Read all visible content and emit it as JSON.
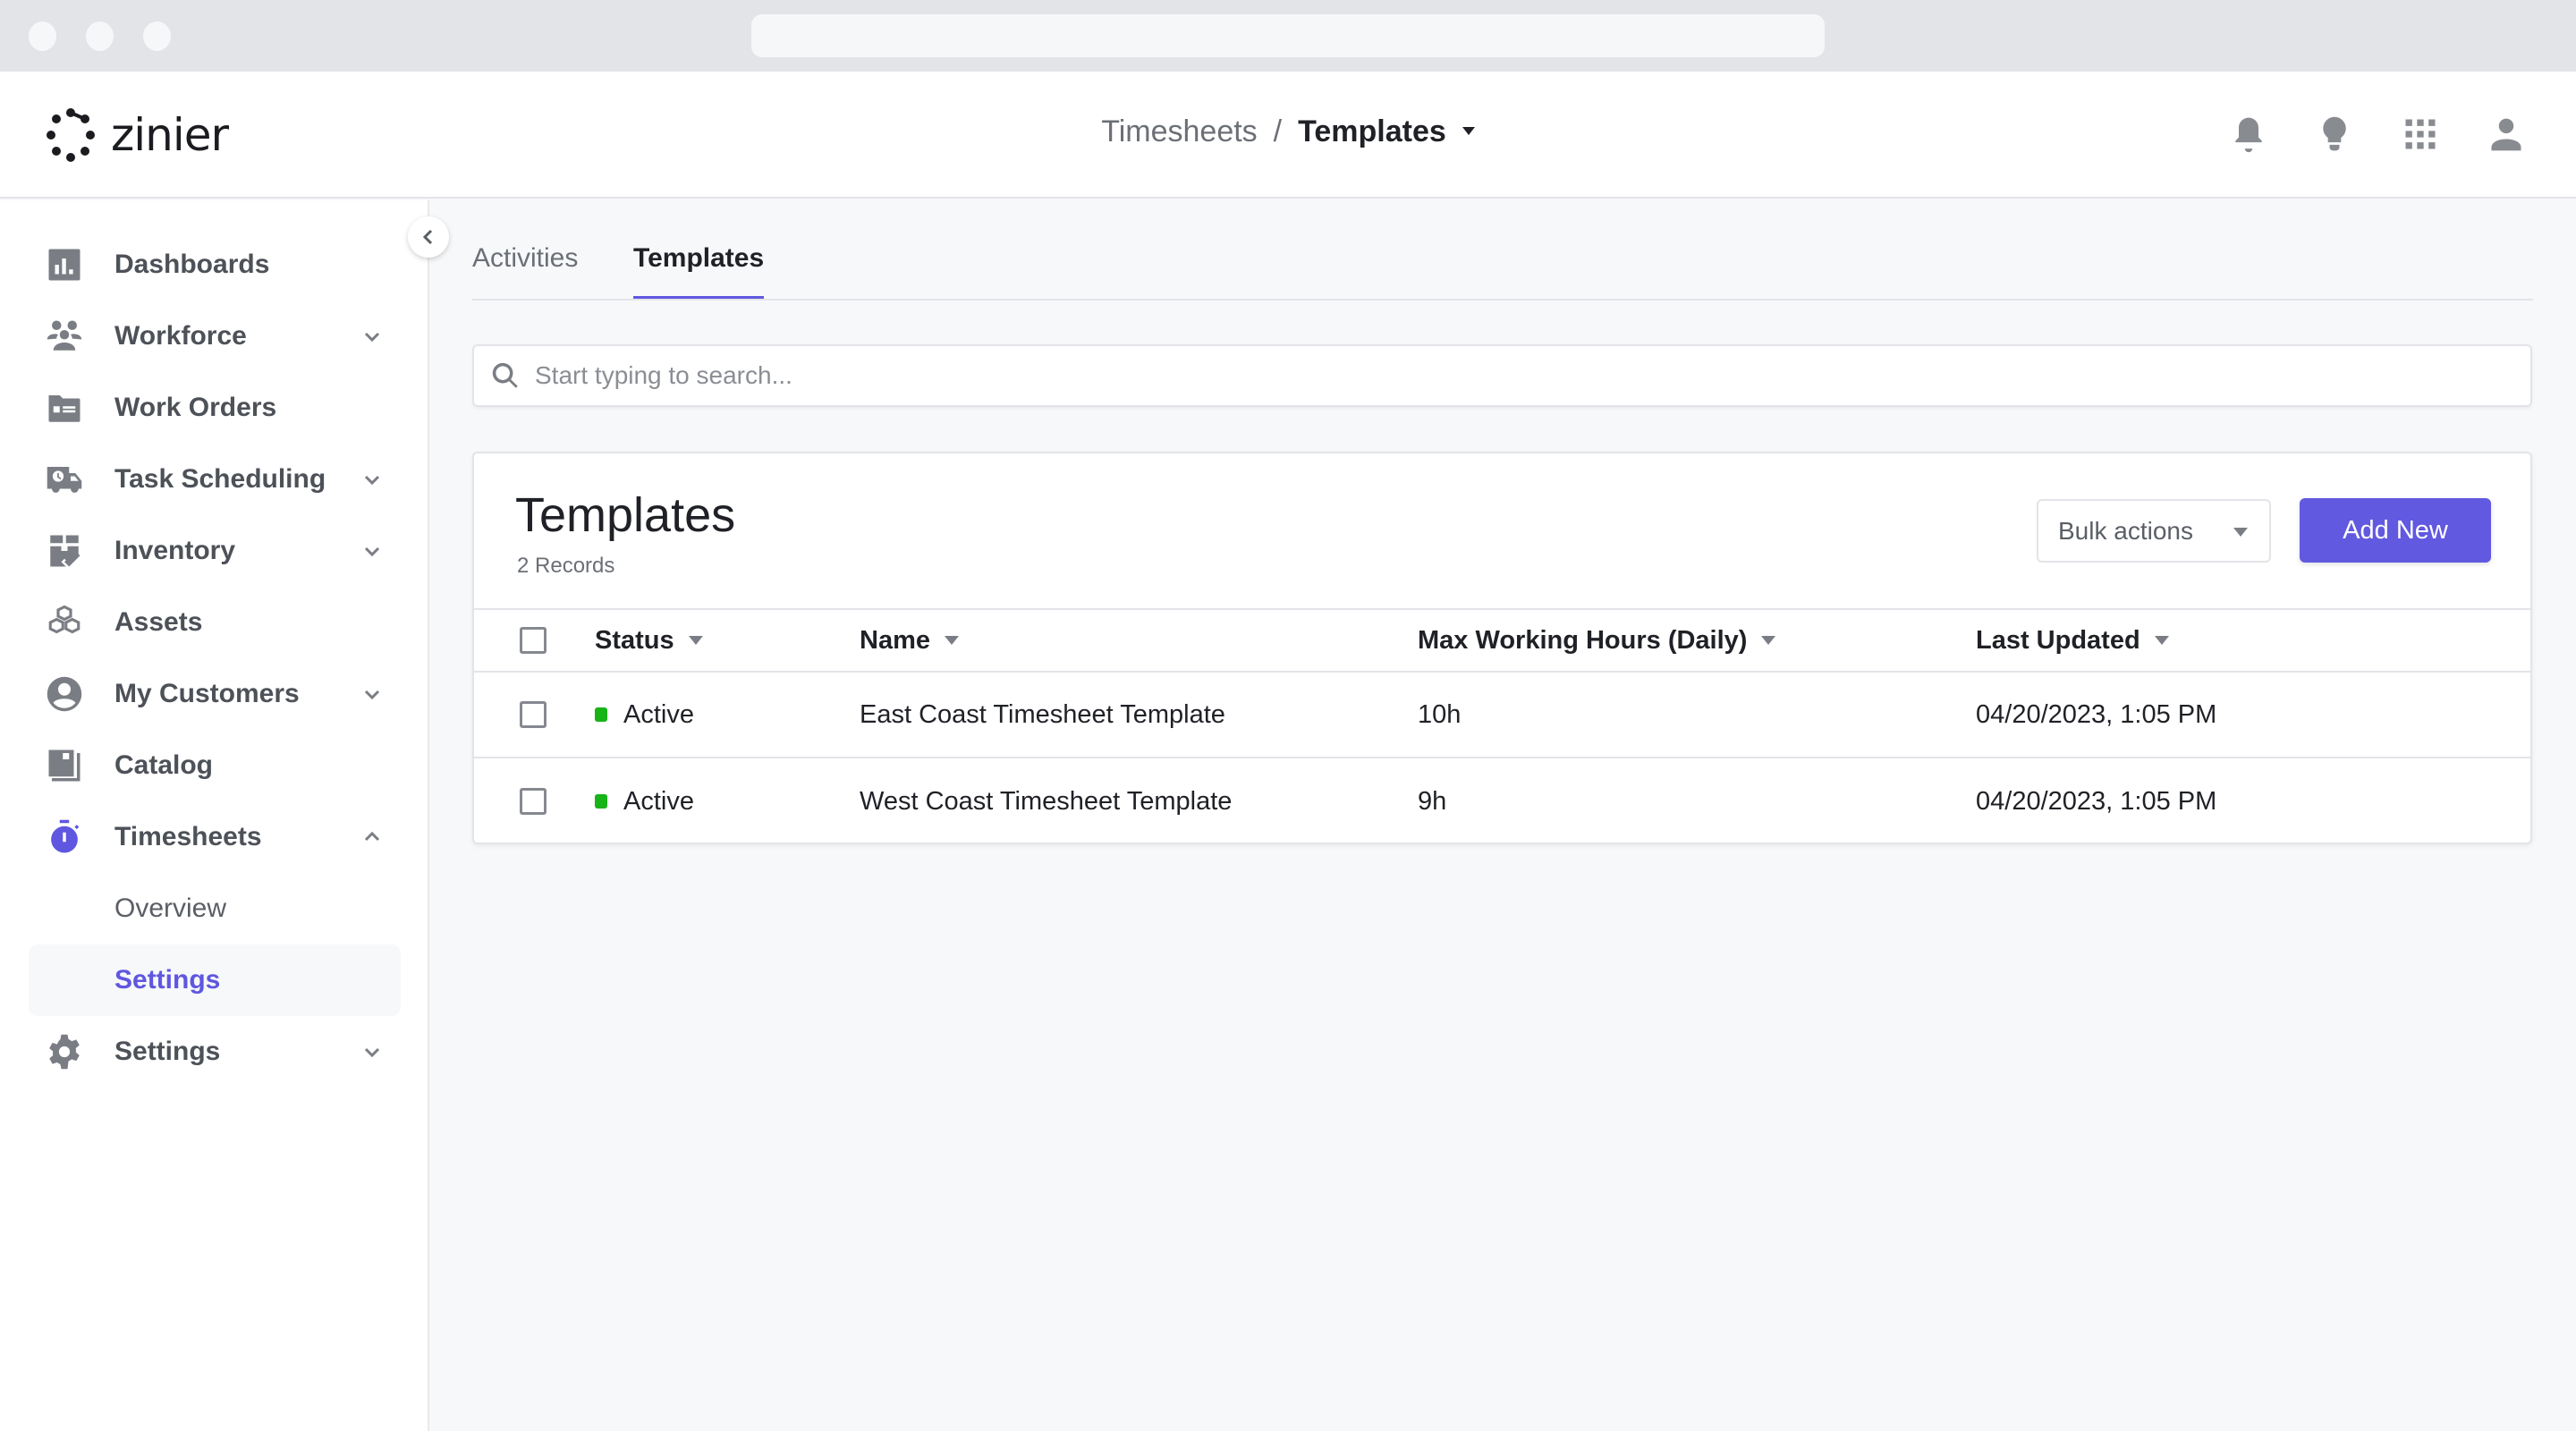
{
  "app": {
    "logo_text": "zinier"
  },
  "header": {
    "breadcrumb": {
      "parent": "Timesheets",
      "separator": "/",
      "current": "Templates"
    },
    "icons": [
      "bell-icon",
      "lightbulb-icon",
      "apps-grid-icon",
      "user-icon"
    ]
  },
  "sidebar": {
    "items": [
      {
        "label": "Dashboards",
        "icon": "bar-chart-icon",
        "expandable": false
      },
      {
        "label": "Workforce",
        "icon": "people-icon",
        "expandable": true,
        "expanded": false
      },
      {
        "label": "Work Orders",
        "icon": "folder-icon",
        "expandable": false
      },
      {
        "label": "Task Scheduling",
        "icon": "truck-clock-icon",
        "expandable": true,
        "expanded": false
      },
      {
        "label": "Inventory",
        "icon": "box-check-icon",
        "expandable": true,
        "expanded": false
      },
      {
        "label": "Assets",
        "icon": "cubes-icon",
        "expandable": false
      },
      {
        "label": "My Customers",
        "icon": "user-circle-icon",
        "expandable": true,
        "expanded": false
      },
      {
        "label": "Catalog",
        "icon": "book-icon",
        "expandable": false
      },
      {
        "label": "Timesheets",
        "icon": "stopwatch-icon",
        "expandable": true,
        "expanded": true,
        "active_color": "#5f57e0"
      },
      {
        "label": "Settings",
        "icon": "gear-icon",
        "expandable": true,
        "expanded": false
      }
    ],
    "timesheets_sub": [
      {
        "label": "Overview",
        "active": false
      },
      {
        "label": "Settings",
        "active": true
      }
    ]
  },
  "tabs": [
    {
      "label": "Activities",
      "active": false
    },
    {
      "label": "Templates",
      "active": true
    }
  ],
  "search": {
    "placeholder": "Start typing to search...",
    "value": ""
  },
  "card": {
    "title": "Templates",
    "record_count": "2 Records",
    "bulk_actions_label": "Bulk actions",
    "add_new_label": "Add New",
    "accent_color": "#6159e0"
  },
  "table": {
    "columns": [
      "Status",
      "Name",
      "Max Working Hours (Daily)",
      "Last Updated"
    ],
    "rows": [
      {
        "status": "Active",
        "status_color": "#17b317",
        "name": "East Coast Timesheet Template",
        "max_hours": "10h",
        "last_updated": "04/20/2023, 1:05 PM"
      },
      {
        "status": "Active",
        "status_color": "#17b317",
        "name": "West Coast Timesheet Template",
        "max_hours": "9h",
        "last_updated": "04/20/2023, 1:05 PM"
      }
    ]
  }
}
